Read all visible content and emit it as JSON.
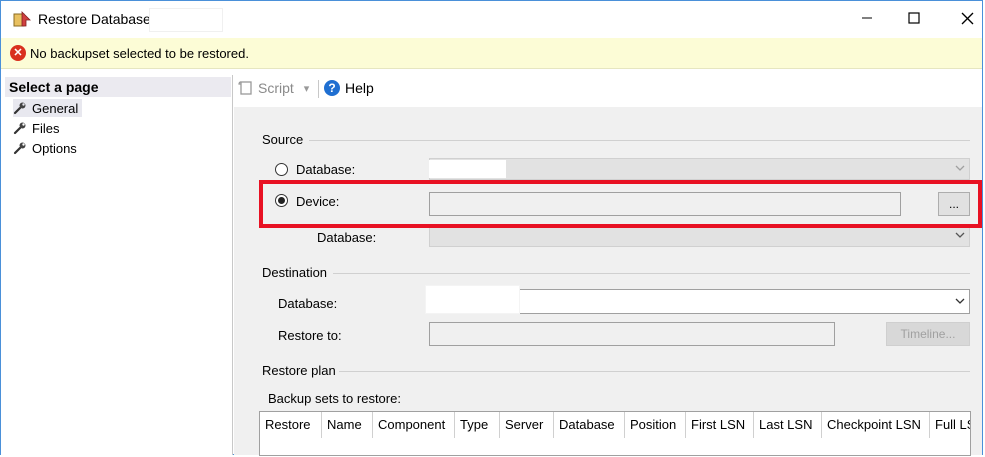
{
  "window": {
    "title": "Restore Database -",
    "minimize_icon": "minimize-icon",
    "maximize_icon": "maximize-icon",
    "close_icon": "close-icon"
  },
  "error_bar": {
    "icon": "error-icon",
    "icon_glyph": "✕",
    "message": "No backupset selected to be restored."
  },
  "left_pane": {
    "header": "Select a page",
    "items": [
      {
        "label": "General",
        "icon": "wrench-icon",
        "selected": true
      },
      {
        "label": "Files",
        "icon": "wrench-icon",
        "selected": false
      },
      {
        "label": "Options",
        "icon": "wrench-icon",
        "selected": false
      }
    ]
  },
  "toolbar": {
    "script_label": "Script",
    "script_arrow": "▾",
    "help_label": "Help",
    "help_glyph": "?"
  },
  "source": {
    "section_label": "Source",
    "database_radio_label": "Database:",
    "device_radio_label": "Device:",
    "device_value": "",
    "browse_label": "...",
    "device_database_label": "Database:",
    "selected_option": "device"
  },
  "destination": {
    "section_label": "Destination",
    "database_label": "Database:",
    "restore_to_label": "Restore to:",
    "timeline_label": "Timeline..."
  },
  "restore_plan": {
    "section_label": "Restore plan",
    "backup_sets_label": "Backup sets to restore:",
    "columns": [
      "Restore",
      "Name",
      "Component",
      "Type",
      "Server",
      "Database",
      "Position",
      "First LSN",
      "Last LSN",
      "Checkpoint LSN",
      "Full LS"
    ]
  },
  "colors": {
    "highlight": "#e81123",
    "error_bar_bg": "#fcfcd6",
    "error_icon": "#d9301e",
    "help_icon": "#1f6fd1"
  }
}
